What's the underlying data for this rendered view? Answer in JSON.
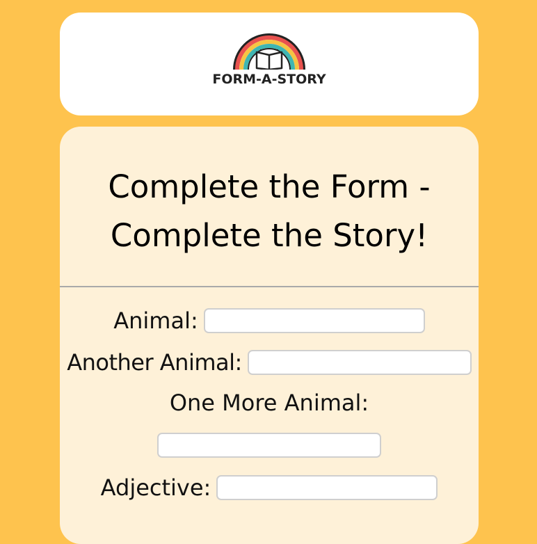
{
  "colors": {
    "page_background": "#FEC34E",
    "header_background": "#FFFFFF",
    "form_background": "#FEF1D8",
    "rainbow": [
      "#E8524F",
      "#F6C443",
      "#3FB6B2",
      "#222222"
    ]
  },
  "header": {
    "logo_icon": "rainbow-book-icon",
    "logo_text": "FORM-A-STORY"
  },
  "form": {
    "title": "Complete the Form - Complete the Story!",
    "fields": [
      {
        "label": "Animal:",
        "value": ""
      },
      {
        "label": "Another Animal:",
        "value": ""
      },
      {
        "label": "One More Animal:",
        "value": ""
      },
      {
        "label": "Adjective:",
        "value": ""
      }
    ]
  }
}
